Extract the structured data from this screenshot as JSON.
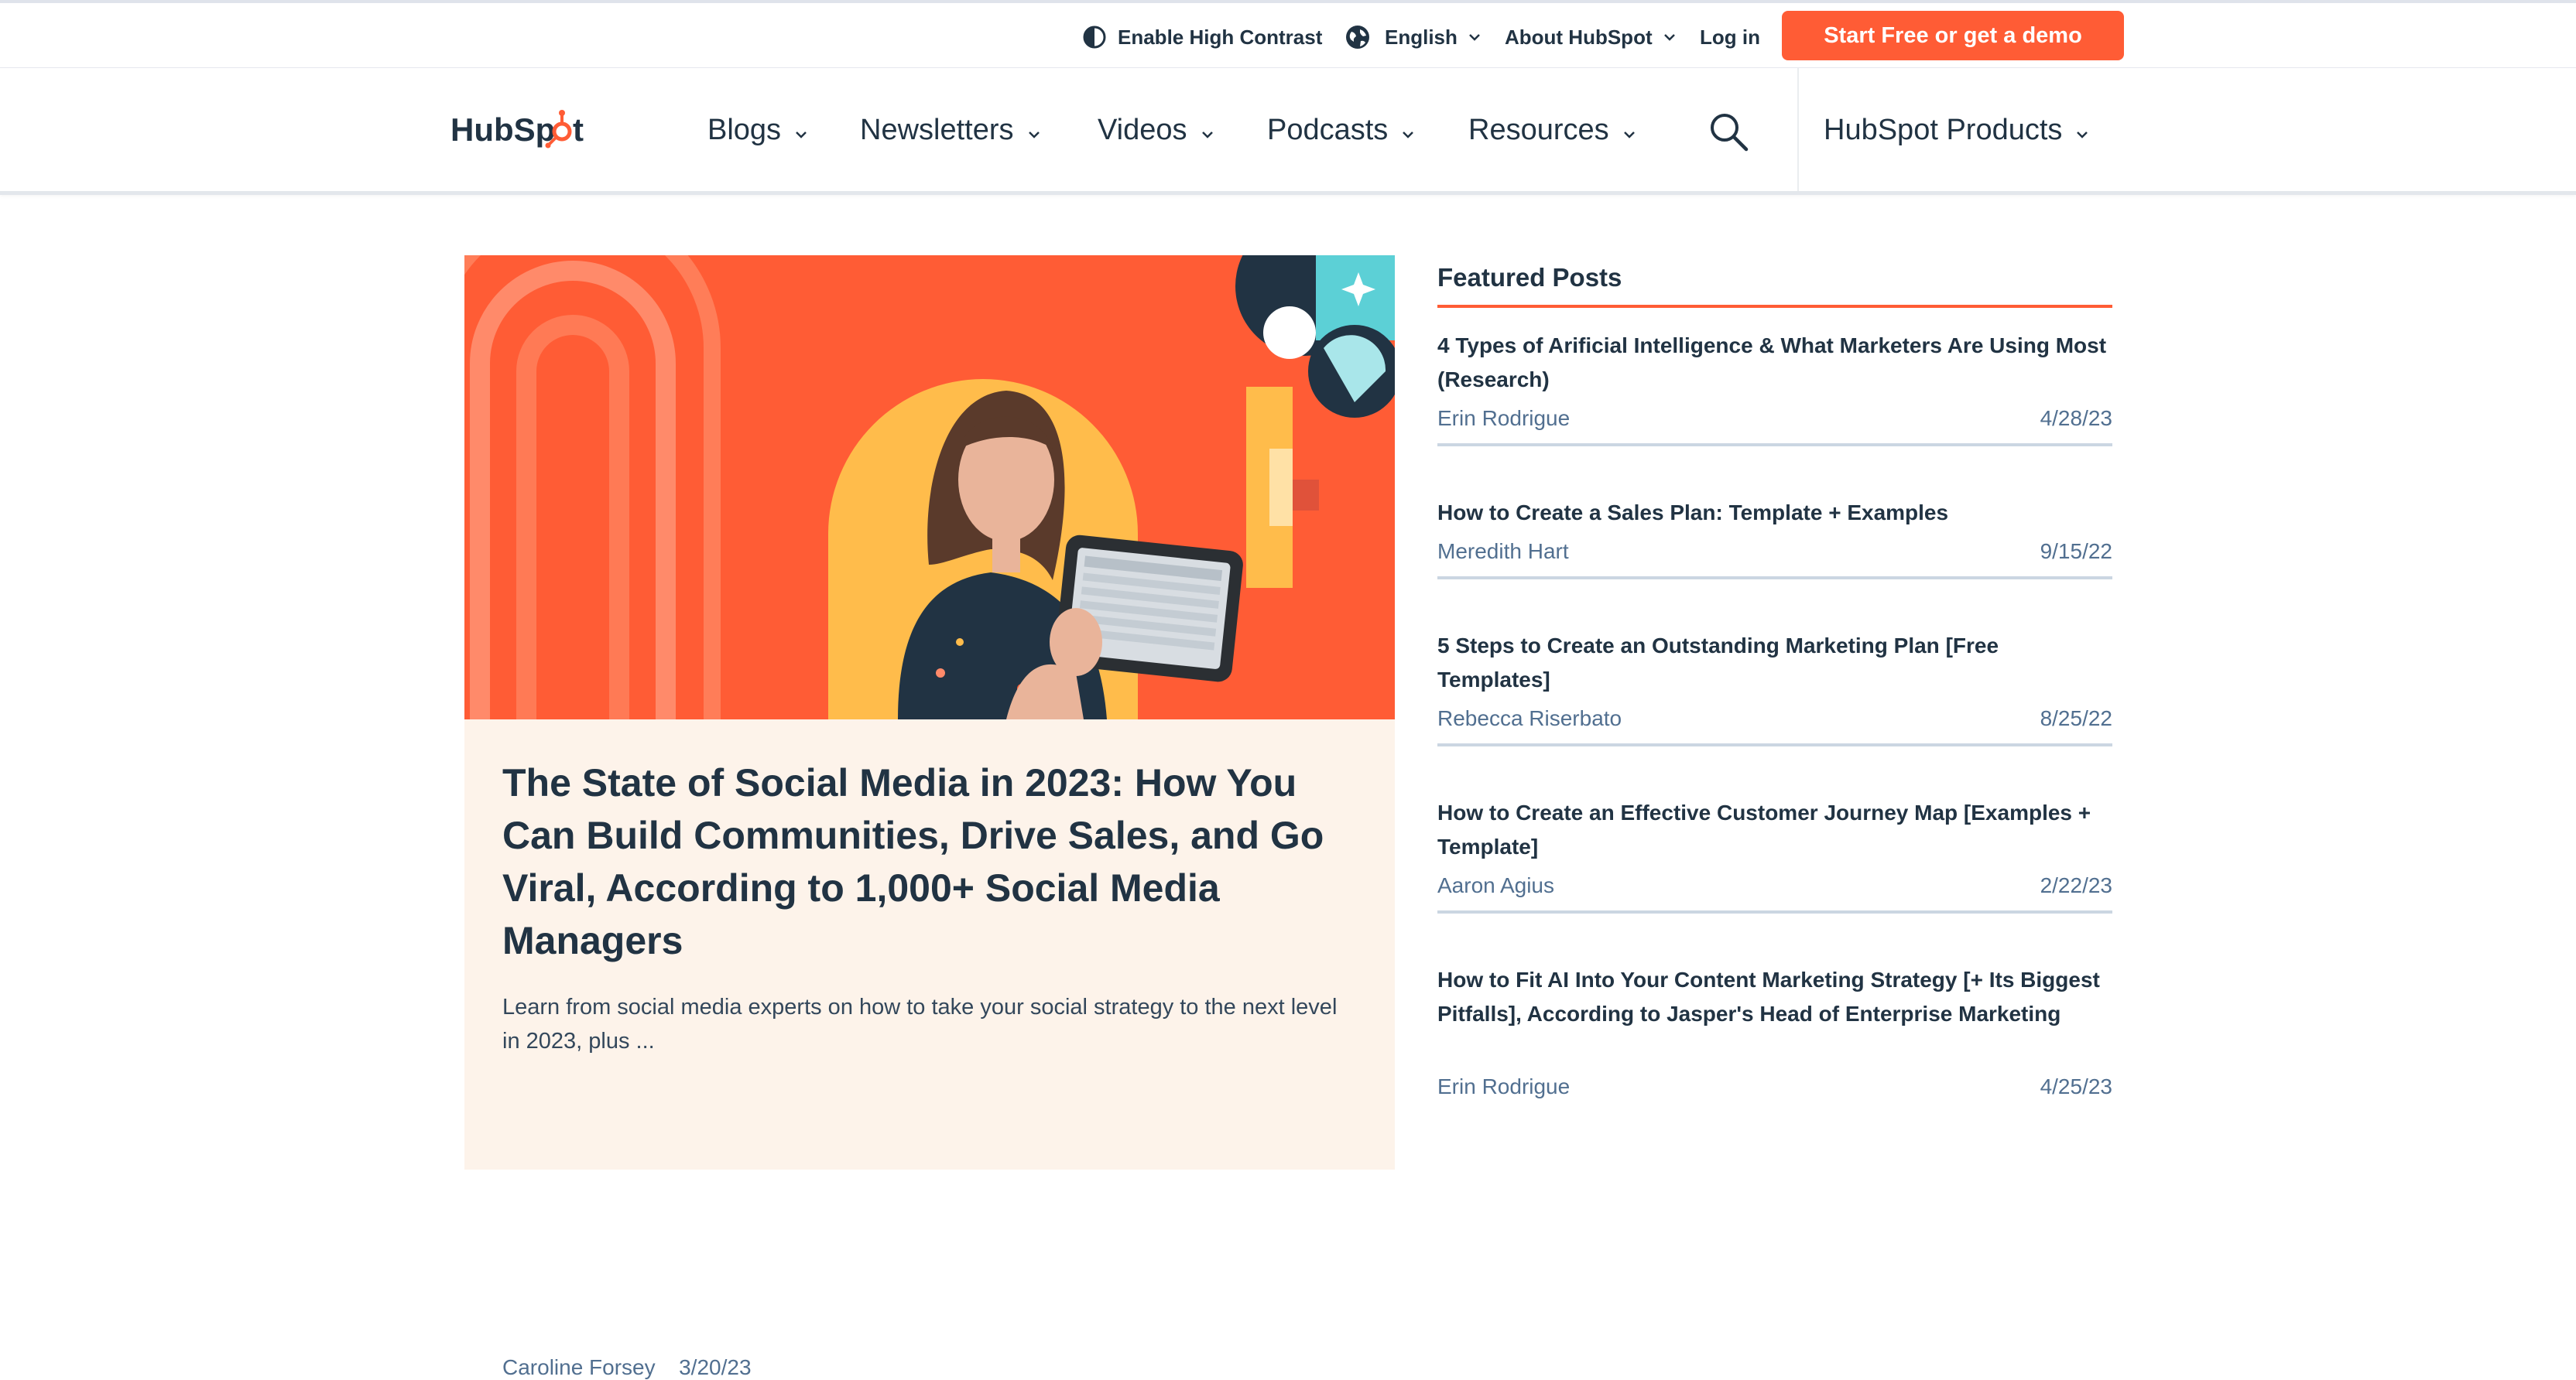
{
  "utility": {
    "contrast_label": "Enable High Contrast",
    "language_label": "English",
    "about_label": "About HubSpot",
    "login_label": "Log in",
    "cta_label": "Start Free or get a demo"
  },
  "nav": {
    "logo_text": "HubSpot",
    "items": [
      "Blogs",
      "Newsletters",
      "Videos",
      "Podcasts",
      "Resources"
    ],
    "products_label": "HubSpot Products"
  },
  "hero": {
    "title": "The State of Social Media in 2023: How You Can Build Communities, Drive Sales, and Go Viral, According to 1,000+ Social Media Managers",
    "excerpt": "Learn from social media experts on how to take your social strategy to the next level in 2023, plus ...",
    "author": "Caroline Forsey",
    "date": "3/20/23"
  },
  "featured": {
    "heading": "Featured Posts",
    "posts": [
      {
        "title": "4 Types of Arificial Intelligence & What Marketers Are Using Most (Research)",
        "author": "Erin Rodrigue",
        "date": "4/28/23"
      },
      {
        "title": "How to Create a Sales Plan: Template + Examples",
        "author": "Meredith Hart",
        "date": "9/15/22"
      },
      {
        "title": "5 Steps to Create an Outstanding Marketing Plan [Free Templates]",
        "author": "Rebecca Riserbato",
        "date": "8/25/22"
      },
      {
        "title": "How to Create an Effective Customer Journey Map [Examples + Template]",
        "author": "Aaron Agius",
        "date": "2/22/23"
      },
      {
        "title": "How to Fit AI Into Your Content Marketing Strategy [+ Its Biggest Pitfalls], According to Jasper's Head of Enterprise Marketing",
        "author": "Erin Rodrigue",
        "date": "4/25/23"
      }
    ]
  },
  "colors": {
    "brand_orange": "#ff5c35",
    "navy": "#213343",
    "meta_blue": "#516f90",
    "hero_bg": "#fdf3ea"
  },
  "icons": [
    "contrast-icon",
    "globe-icon",
    "chevron-down-icon",
    "search-icon",
    "hubspot-sprocket-icon"
  ]
}
